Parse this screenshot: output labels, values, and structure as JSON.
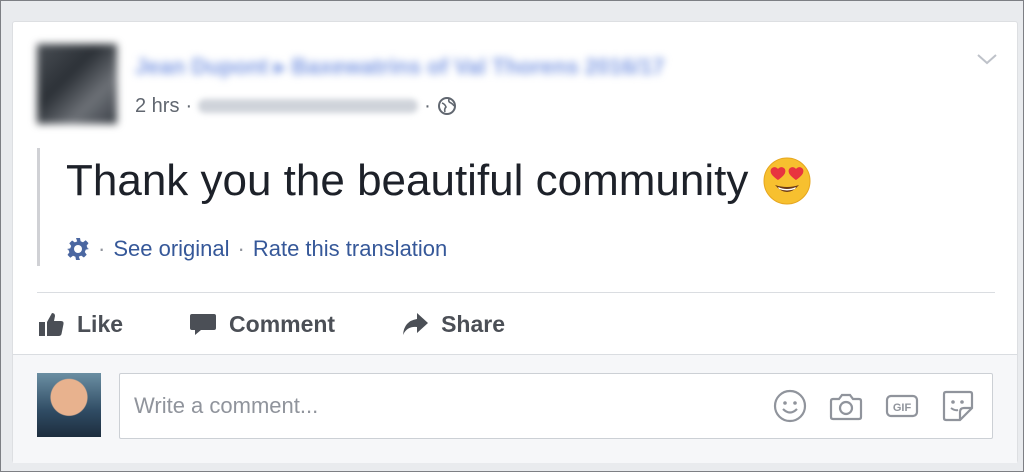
{
  "post": {
    "author": "Jean Dupont ▸ Baxewatrins of Val Thorens 2016/17",
    "time": "2 hrs",
    "separator": "·",
    "text": "Thank you the beautiful community",
    "emoji": "heart-eyes",
    "translation": {
      "see_original": "See original",
      "rate": "Rate this translation"
    }
  },
  "actions": {
    "like": "Like",
    "comment": "Comment",
    "share": "Share"
  },
  "composer": {
    "placeholder": "Write a comment...",
    "icons": [
      "smiley-icon",
      "camera-icon",
      "gif-icon",
      "sticker-icon"
    ]
  },
  "colors": {
    "link": "#365899",
    "action_text": "#4b4f56",
    "background": "#e9ebee"
  }
}
